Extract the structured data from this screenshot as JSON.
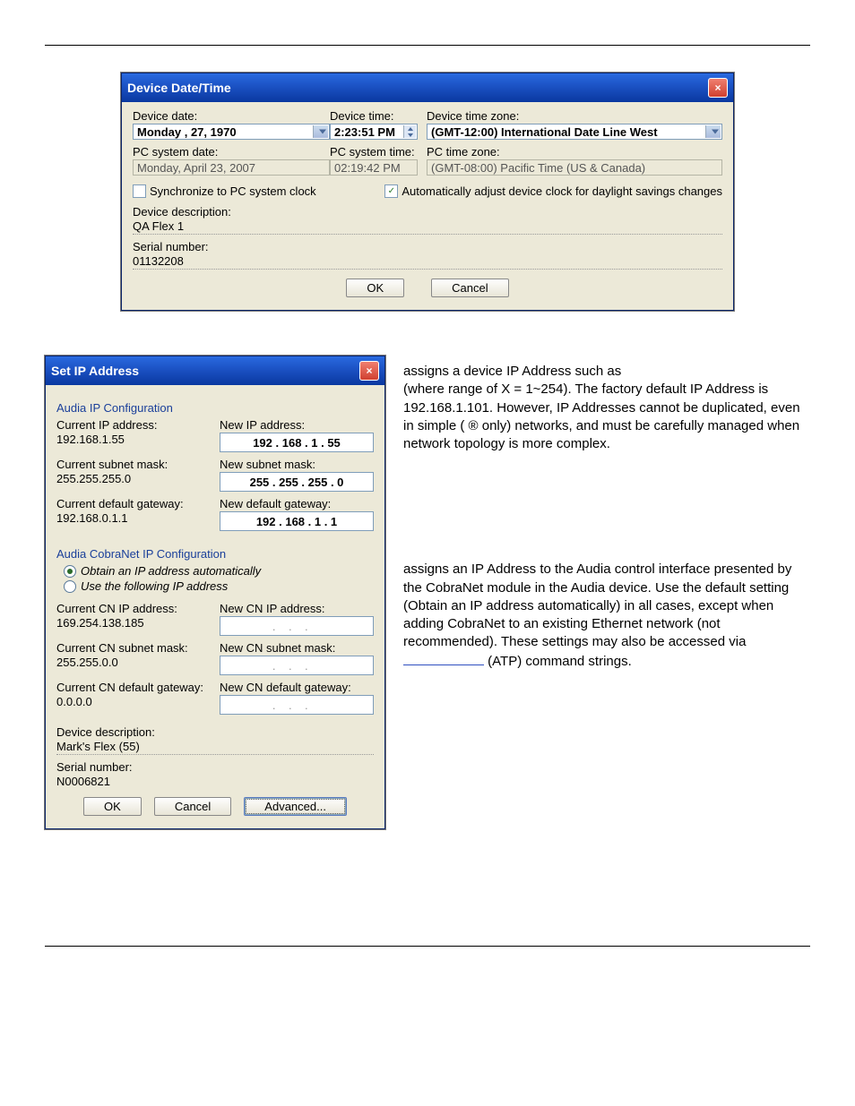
{
  "dialog1": {
    "title": "Device Date/Time",
    "device_date_lbl": "Device date:",
    "device_date_val": "Monday ,          27, 1970",
    "device_time_lbl": "Device time:",
    "device_time_val": "2:23:51 PM",
    "device_tz_lbl": "Device time zone:",
    "device_tz_val": "(GMT-12:00) International Date Line West",
    "pc_date_lbl": "PC system date:",
    "pc_date_val": "Monday, April 23, 2007",
    "pc_time_lbl": "PC system time:",
    "pc_time_val": "02:19:42 PM",
    "pc_tz_lbl": "PC time zone:",
    "pc_tz_val": "(GMT-08:00) Pacific Time (US & Canada)",
    "sync_lbl": "Synchronize to PC system clock",
    "auto_lbl": "Automatically adjust device clock for daylight savings changes",
    "desc_lbl": "Device description:",
    "desc_val": "QA Flex 1",
    "serial_lbl": "Serial number:",
    "serial_val": "01132208",
    "ok": "OK",
    "cancel": "Cancel"
  },
  "dialog2": {
    "title": "Set IP Address",
    "group1": "Audia IP Configuration",
    "cur_ip_lbl": "Current IP address:",
    "cur_ip_val": "192.168.1.55",
    "new_ip_lbl": "New IP address:",
    "new_ip_val": "192 . 168 .   1   .  55",
    "cur_sub_lbl": "Current subnet mask:",
    "cur_sub_val": "255.255.255.0",
    "new_sub_lbl": "New subnet mask:",
    "new_sub_val": "255 . 255 . 255 .   0",
    "cur_gw_lbl": "Current default gateway:",
    "cur_gw_val": "192.168.0.1.1",
    "new_gw_lbl": "New default gateway:",
    "new_gw_val": "192 . 168 .   1   .   1",
    "group2": "Audia CobraNet IP Configuration",
    "radio_auto": "Obtain an IP address automatically",
    "radio_manual": "Use the following IP address",
    "cn_cur_ip_lbl": "Current CN IP address:",
    "cn_cur_ip_val": "169.254.138.185",
    "cn_new_ip_lbl": "New CN IP address:",
    "cn_cur_sub_lbl": "Current CN subnet mask:",
    "cn_cur_sub_val": "255.255.0.0",
    "cn_new_sub_lbl": "New CN subnet mask:",
    "cn_cur_gw_lbl": "Current CN default gateway:",
    "cn_cur_gw_val": "0.0.0.0",
    "cn_new_gw_lbl": "New CN default gateway:",
    "desc_lbl": "Device description:",
    "desc_val": "Mark's Flex (55)",
    "serial_lbl": "Serial number:",
    "serial_val": "N0006821",
    "ok": "OK",
    "cancel": "Cancel",
    "advanced": "Advanced..."
  },
  "text": {
    "para1": " assigns a device IP Address such as ",
    "para1b": " (where range of X = 1~254). The factory default IP Address is 192.168.1.101. However, IP Addresses cannot be duplicated, even in simple (",
    "para1c": "® only) networks, and must be carefully managed when network topology is more complex.",
    "para2": "assigns an IP Address to the Audia control interface presented by the CobraNet module in the Audia device. Use the default setting (Obtain an IP address automatically) in all cases, except when adding CobraNet to an existing Ethernet network (not recommended). These settings may also be accessed via ",
    "para2b": " (ATP) command strings."
  }
}
